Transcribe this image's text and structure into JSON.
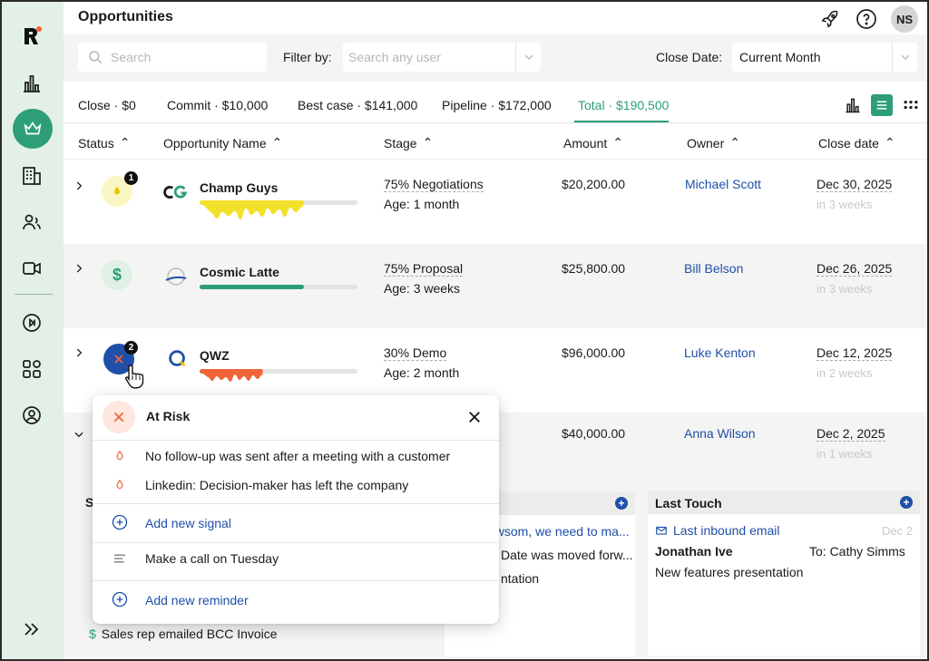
{
  "header": {
    "title": "Opportunities",
    "avatar_initials": "NS"
  },
  "filters": {
    "search_placeholder": "Search",
    "filter_label": "Filter by:",
    "user_placeholder": "Search any user",
    "close_date_label": "Close Date:",
    "close_date_value": "Current Month"
  },
  "summary": {
    "tabs": [
      {
        "label": "Close · $0"
      },
      {
        "label": "Commit · $10,000"
      },
      {
        "label": "Best case · $141,000"
      },
      {
        "label": "Pipeline · $172,000"
      },
      {
        "label": "Total · $190,500"
      }
    ],
    "active_tab": "Total · $190,500"
  },
  "table": {
    "columns": [
      "Status",
      "Opportunity Name",
      "Stage",
      "Amount",
      "Owner",
      "Close date"
    ],
    "rows": [
      {
        "name": "Champ Guys",
        "logo": "CG",
        "stage": "75% Negotiations",
        "age": "Age: 1 month",
        "amount": "$20,200.00",
        "owner": "Michael Scott",
        "close_date": "Dec 30, 2025",
        "relative": "in 3 weeks",
        "badge": "1",
        "health": 0.66,
        "health_color": "#f2e12a"
      },
      {
        "name": "Cosmic Latte",
        "logo": "CL",
        "stage": "75% Proposal",
        "age": "Age: 3 weeks",
        "amount": "$25,800.00",
        "owner": "Bill Belson",
        "close_date": "Dec 26, 2025",
        "relative": "in 3 weeks",
        "badge": "",
        "health": 0.66,
        "health_color": "#2e9e77"
      },
      {
        "name": "QWZ",
        "logo": "Q",
        "stage": "30% Demo",
        "age": "Age: 2 month",
        "amount": "$96,000.00",
        "owner": "Luke Kenton",
        "close_date": "Dec 12, 2025",
        "relative": "in 2 weeks",
        "badge": "2",
        "health": 0.4,
        "health_color": "#f0643a"
      },
      {
        "name": "",
        "logo": "",
        "stage": "",
        "age": "",
        "amount": "$40,000.00",
        "owner": "Anna Wilson",
        "close_date": "Dec 2, 2025",
        "relative": "in 1 weeks",
        "badge": "",
        "health": 0,
        "health_color": ""
      }
    ]
  },
  "lower": {
    "left_partial_letter": "S",
    "left_item": "Sales rep emailed BCC Invoice",
    "mid_lines": [
      "ewsom, we need to ma...",
      "Date was moved forw...",
      "ntation"
    ],
    "last_touch": {
      "title": "Last Touch",
      "type": "Last inbound email",
      "date": "Dec 2",
      "from": "Jonathan Ive",
      "to": "To: Cathy Simms",
      "subject": "New features presentation"
    }
  },
  "popover": {
    "title": "At Risk",
    "signals": [
      "No follow-up was sent after a meeting with a customer",
      "Linkedin: Decision-maker has left the company"
    ],
    "add_signal": "Add new signal",
    "reminder": "Make a call on Tuesday",
    "add_reminder": "Add new reminder"
  },
  "colors": {
    "brand": "#2e9e77",
    "link": "#1f4fa8",
    "risk": "#f0643a",
    "sidebar_bg": "#e3f0e8"
  }
}
